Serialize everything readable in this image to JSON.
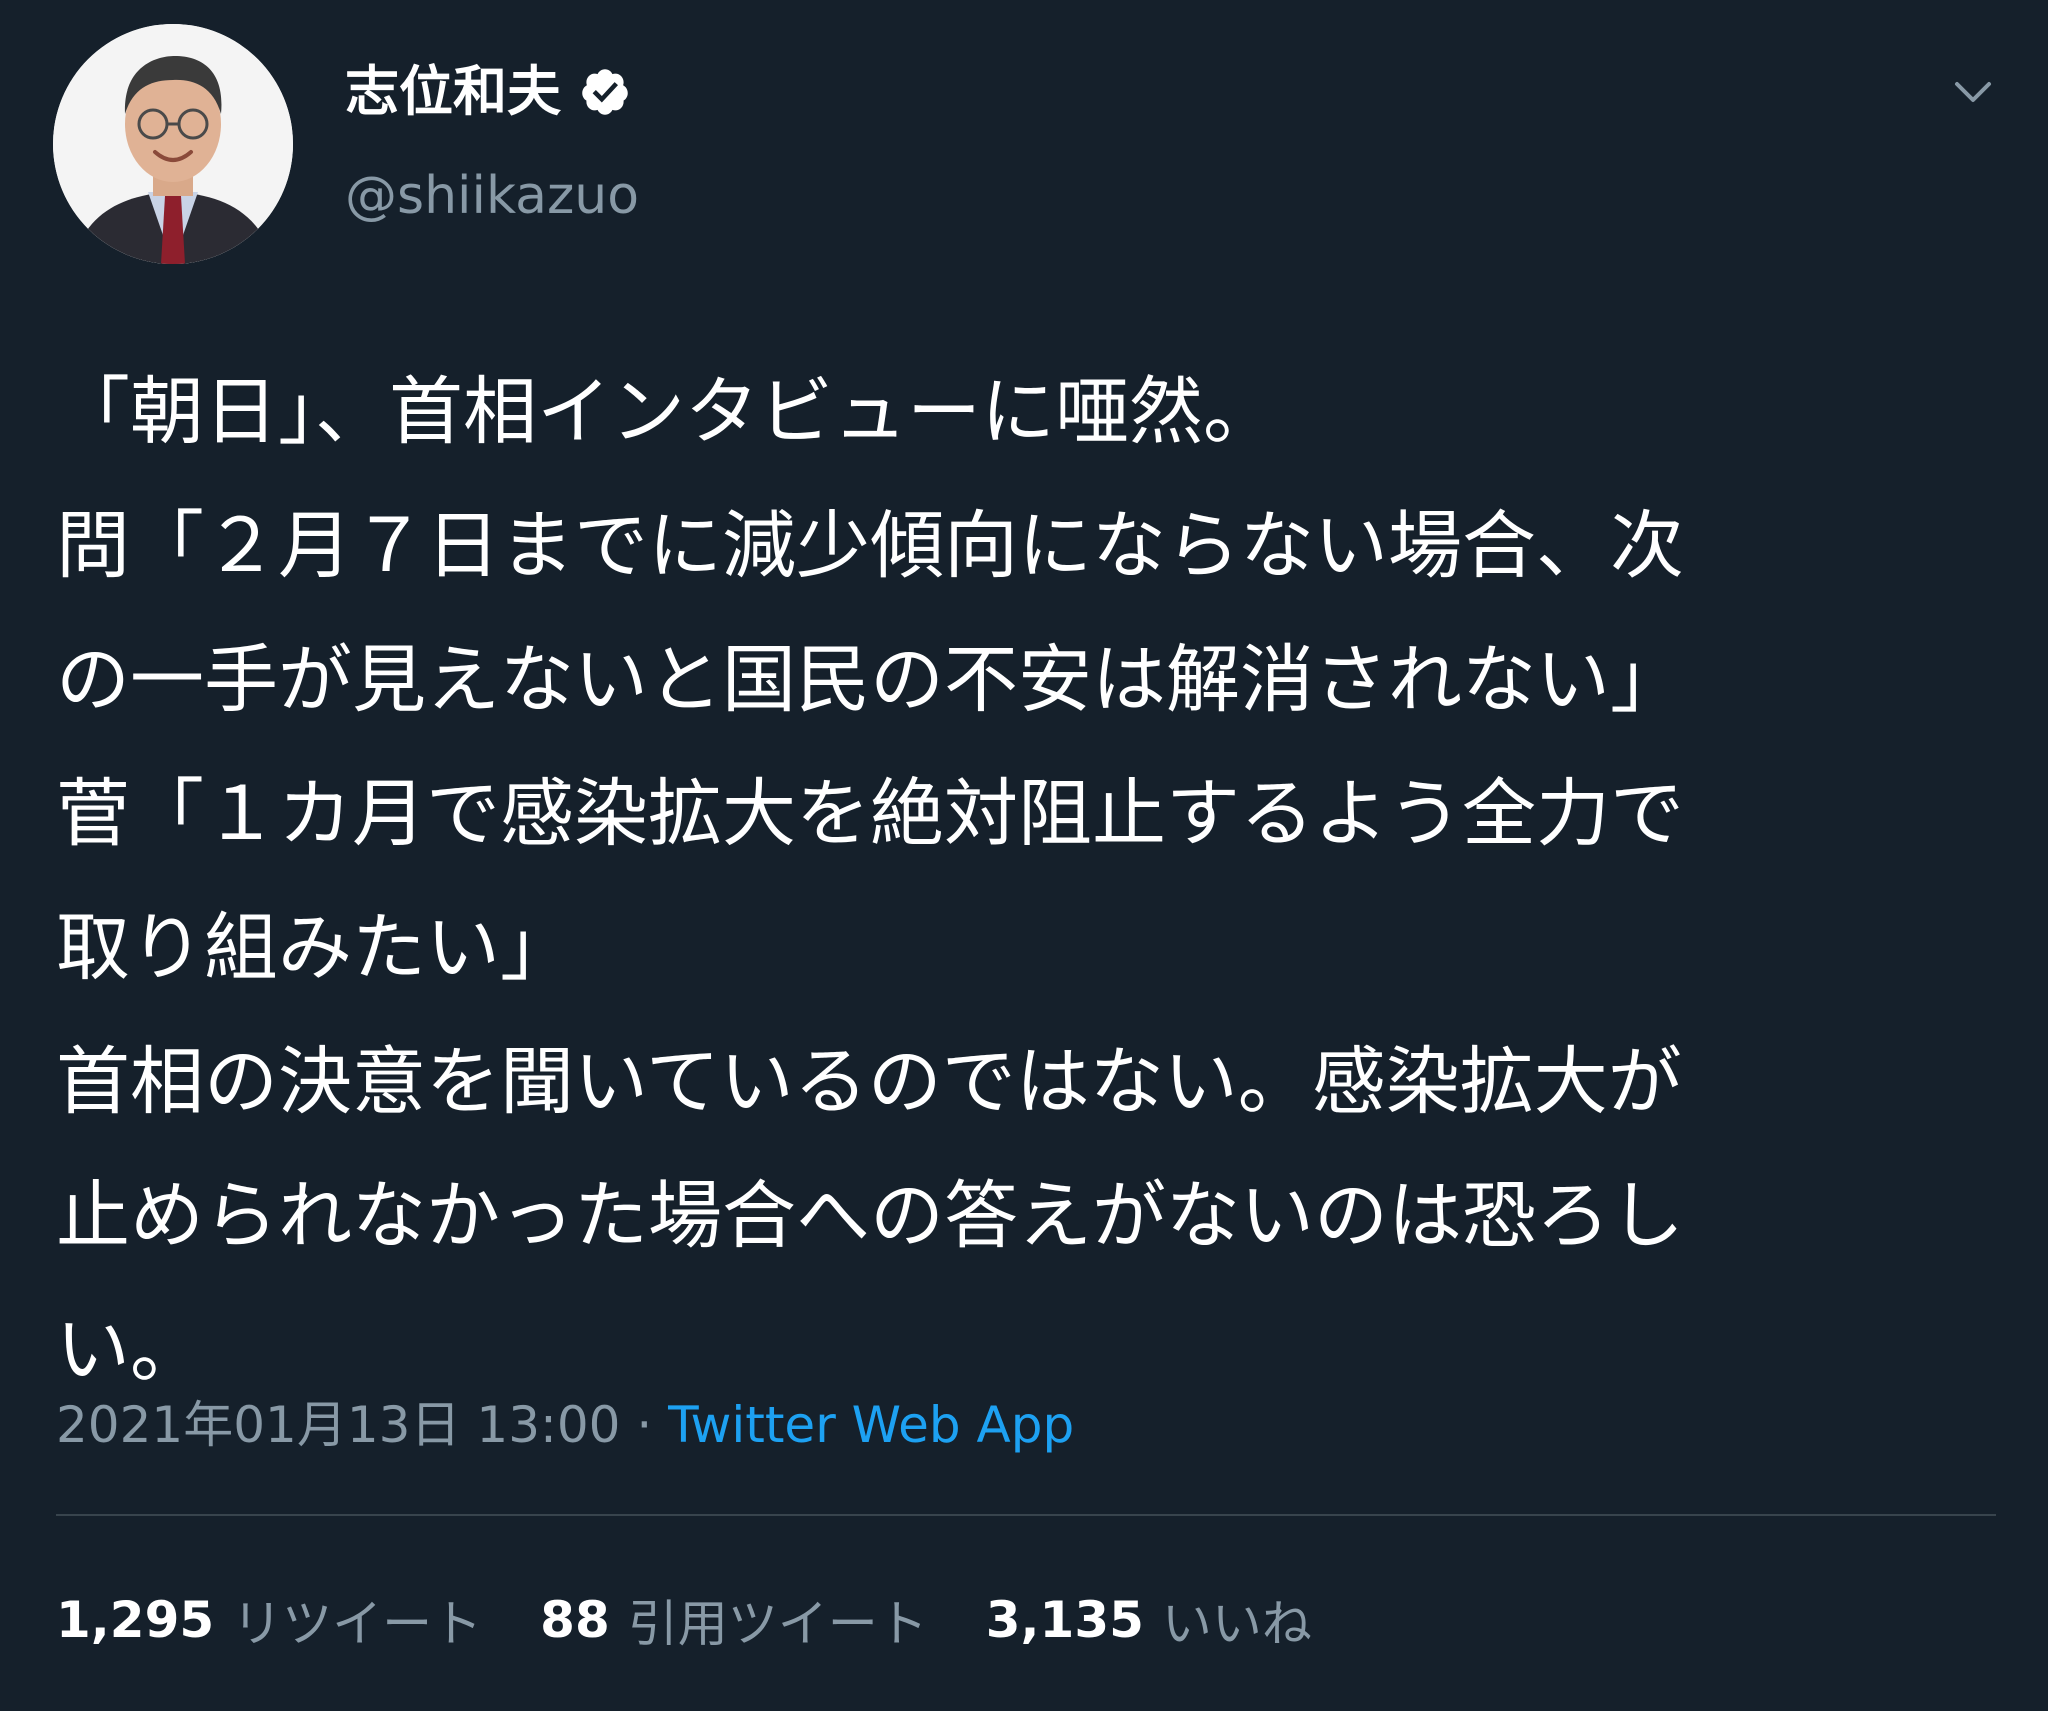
{
  "user": {
    "display_name": "志位和夫",
    "handle": "@shiikazuo",
    "verified": true,
    "avatar_icon": "profile-photo"
  },
  "tweet": {
    "lines": [
      "「朝日」、首相インタビューに唖然。",
      "問「２月７日までに減少傾向にならない場合、次",
      "の一手が見えないと国民の不安は解消されない」",
      "菅「１カ月で感染拡大を絶対阻止するよう全力で",
      "取り組みたい」",
      "首相の決意を聞いているのではない。感染拡大が",
      "止められなかった場合への答えがないのは恐ろし",
      "い。"
    ]
  },
  "meta": {
    "timestamp": "2021年01月13日 13:00",
    "separator": " · ",
    "source": "Twitter Web App"
  },
  "stats": [
    {
      "count": "1,295",
      "label": "リツイート"
    },
    {
      "count": "88",
      "label": "引用ツイート"
    },
    {
      "count": "3,135",
      "label": "いいね"
    }
  ],
  "colors": {
    "background": "#15202b",
    "text_primary": "#ffffff",
    "text_secondary": "#8899a6",
    "link": "#1da1f2",
    "divider": "#38444d"
  },
  "icons": {
    "verified": "verified-badge-icon",
    "menu": "chevron-down-icon"
  }
}
